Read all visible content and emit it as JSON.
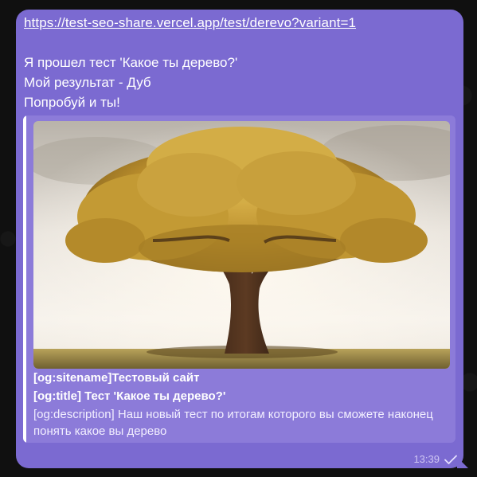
{
  "message": {
    "link_text": "https://test-seo-share.vercel.app/test/derevo?variant=1",
    "lines": [
      "Я прошел тест 'Какое ты дерево?'",
      "Мой результат - Дуб",
      "Попробуй и ты!"
    ],
    "time": "13:39",
    "status_icon": "single-check-icon"
  },
  "link_preview": {
    "image_icon": "oak-tree-image",
    "sitename": "[og:sitename]Тестовый сайт",
    "title": "[og:title] Тест 'Какое ты дерево?'",
    "description": "[og:description] Наш новый тест по итогам которого вы сможете наконец понять какое вы дерево"
  },
  "colors": {
    "bubble": "#7b6ad1",
    "preview_bg": "#8c7bd9",
    "accent_bar": "#ffffff",
    "chat_background": "#101010"
  }
}
